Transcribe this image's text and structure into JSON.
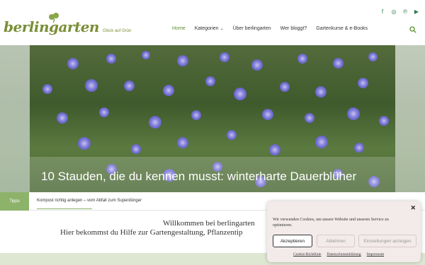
{
  "brand": {
    "name": "berlingarten",
    "tagline": "Glück auf Grün",
    "color": "#7a8e36"
  },
  "social": [
    "facebook-icon",
    "instagram-icon",
    "pinterest-icon",
    "youtube-icon"
  ],
  "nav": {
    "items": [
      {
        "label": "Home",
        "active": true
      },
      {
        "label": "Kategorien",
        "dropdown": true
      },
      {
        "label": "Über berlingarten"
      },
      {
        "label": "Wer bloggt?"
      },
      {
        "label": "Gartenkurse & e-Books"
      }
    ],
    "search_icon": "search-icon"
  },
  "hero": {
    "title": "10 Stauden, die du kennen musst: winterharte Dauerblüher"
  },
  "ticker": {
    "label": "Tipps",
    "text": "Kompost richtig anlegen – vom Abfall zum Superdünger"
  },
  "welcome": {
    "line1": "Willkommen bei berlingarten",
    "line2": "Hier bekommst du Hilfe zur Gartengestaltung, Pflanzentip"
  },
  "cookie": {
    "text": "Wir verwenden Cookies, um unsere Website und unseren Service zu optimieren.",
    "accept": "Akzeptieren",
    "deny": "Ablehnen",
    "settings": "Einstellungen anzeigen",
    "links": [
      "Cookie-Richtlinie",
      "Datenschutzerklärung",
      "Impressum"
    ]
  },
  "colors": {
    "accent": "#5a8f2e",
    "ticker_label_bg": "#8db36a",
    "social_icon": "#2e7d4f"
  }
}
